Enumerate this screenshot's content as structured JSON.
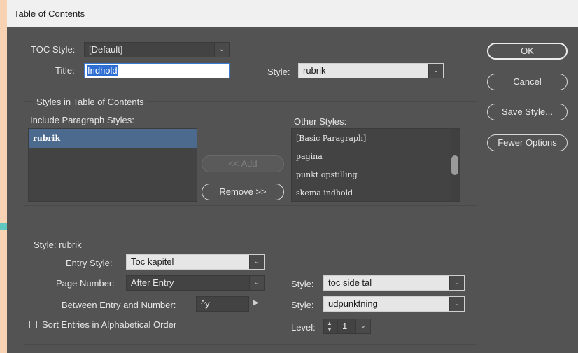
{
  "window": {
    "title": "Table of Contents"
  },
  "toc_style": {
    "label": "TOC Style:",
    "value": "[Default]"
  },
  "title": {
    "label": "Title:",
    "value": "Indhold"
  },
  "title_style": {
    "label": "Style:",
    "value": "rubrik"
  },
  "styles_group": {
    "heading": "Styles in Table of Contents",
    "include_label": "Include Paragraph Styles:",
    "include_items": [
      "rubrik"
    ],
    "other_label": "Other Styles:",
    "other_items": [
      "[Basic Paragraph]",
      "pagina",
      "punkt opstilling",
      "skema indhold"
    ],
    "add_label": "<< Add",
    "remove_label": "Remove >>"
  },
  "buttons": {
    "ok": "OK",
    "cancel": "Cancel",
    "save_style": "Save Style...",
    "fewer_options": "Fewer Options"
  },
  "style_group": {
    "heading": "Style: rubrik",
    "entry_style_label": "Entry Style:",
    "entry_style_value": "Toc kapitel",
    "page_number_label": "Page Number:",
    "page_number_value": "After Entry",
    "between_label": "Between Entry and Number:",
    "between_value": "^y",
    "sort_label": "Sort Entries in Alphabetical Order",
    "pn_style_label": "Style:",
    "pn_style_value": "toc side tal",
    "between_style_label": "Style:",
    "between_style_value": "udpunktning",
    "level_label": "Level:",
    "level_value": "1"
  },
  "icons": {
    "dropdown": "chevron-down-icon",
    "stepper": "stepper-arrows-icon",
    "arrow": "triangle-right-icon"
  }
}
